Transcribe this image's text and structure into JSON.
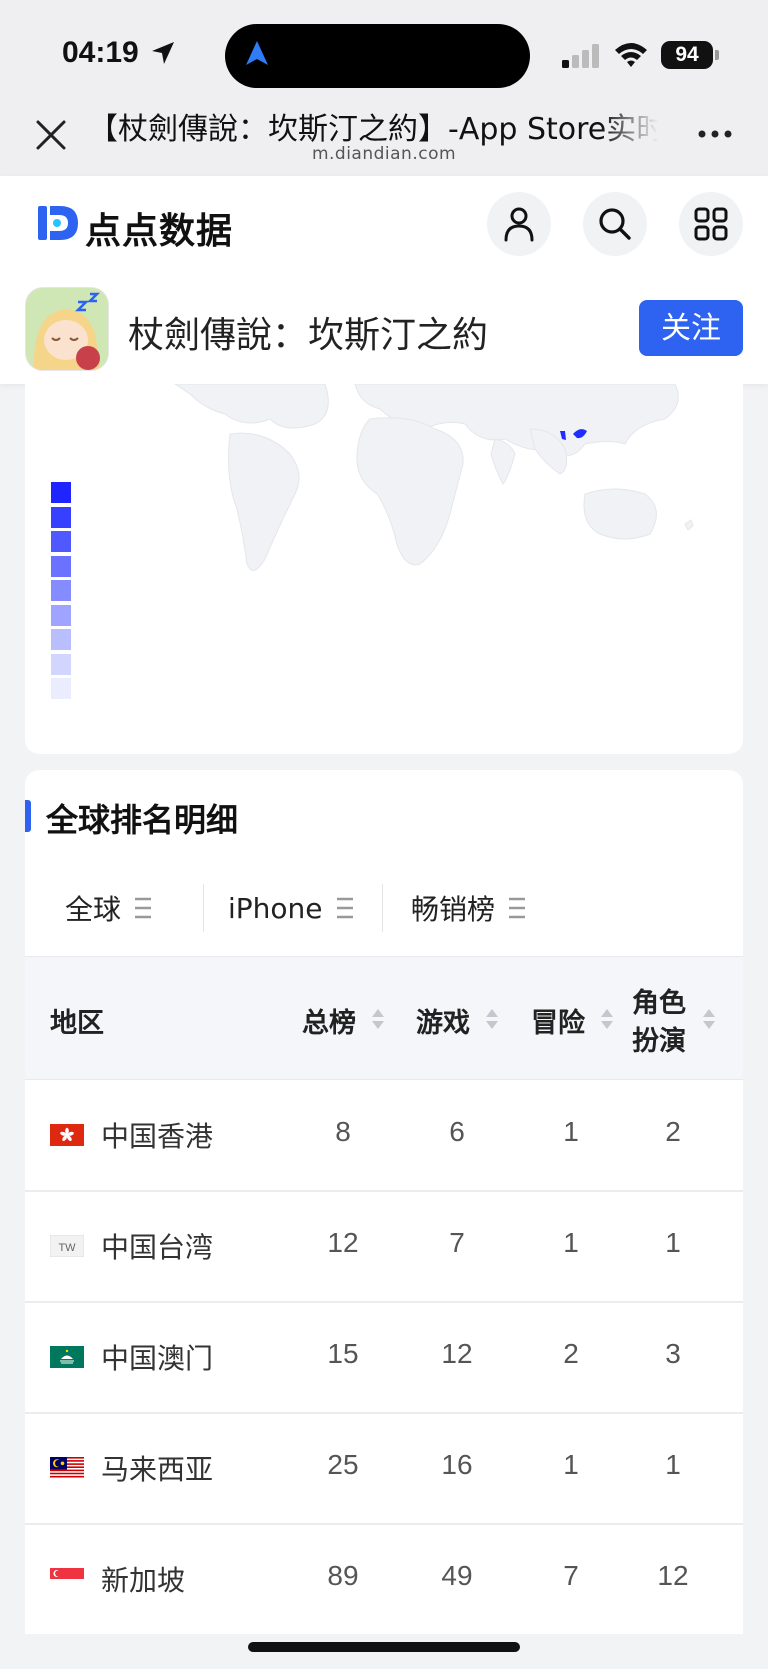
{
  "status_bar": {
    "time": "04:19",
    "battery": "94"
  },
  "browser": {
    "title": "【杖劍傳說：坎斯汀之約】-App Store实时排名",
    "url": "m.diandian.com"
  },
  "header": {
    "logo_text": "点点数据",
    "app_name": "杖劍傳說：坎斯汀之約",
    "follow_label": "关注"
  },
  "colors": {
    "accent": "#2d63f0",
    "map_highlight": "#1f2dff"
  },
  "map_legend": [
    "#1e25ff",
    "#3840ff",
    "#5058ff",
    "#6a72ff",
    "#858cff",
    "#9fa5ff",
    "#b9beff",
    "#d2d6ff",
    "#ebedff"
  ],
  "ranking": {
    "title": "全球排名明细",
    "filters": [
      {
        "label": "全球"
      },
      {
        "label": "iPhone"
      },
      {
        "label": "畅销榜"
      }
    ],
    "columns": {
      "region": "地区",
      "total": "总榜",
      "games": "游戏",
      "adventure": "冒险",
      "rpg_line1": "角色",
      "rpg_line2": "扮演"
    },
    "rows": [
      {
        "region": "中国香港",
        "flag": "hong-kong-flag",
        "total": "8",
        "games": "6",
        "adventure": "1",
        "rpg": "2"
      },
      {
        "region": "中国台湾",
        "flag": "taiwan-flag",
        "total": "12",
        "games": "7",
        "adventure": "1",
        "rpg": "1"
      },
      {
        "region": "中国澳门",
        "flag": "macau-flag",
        "total": "15",
        "games": "12",
        "adventure": "2",
        "rpg": "3"
      },
      {
        "region": "马来西亚",
        "flag": "malaysia-flag",
        "total": "25",
        "games": "16",
        "adventure": "1",
        "rpg": "1"
      },
      {
        "region": "新加坡",
        "flag": "singapore-flag",
        "total": "89",
        "games": "49",
        "adventure": "7",
        "rpg": "12"
      }
    ]
  }
}
